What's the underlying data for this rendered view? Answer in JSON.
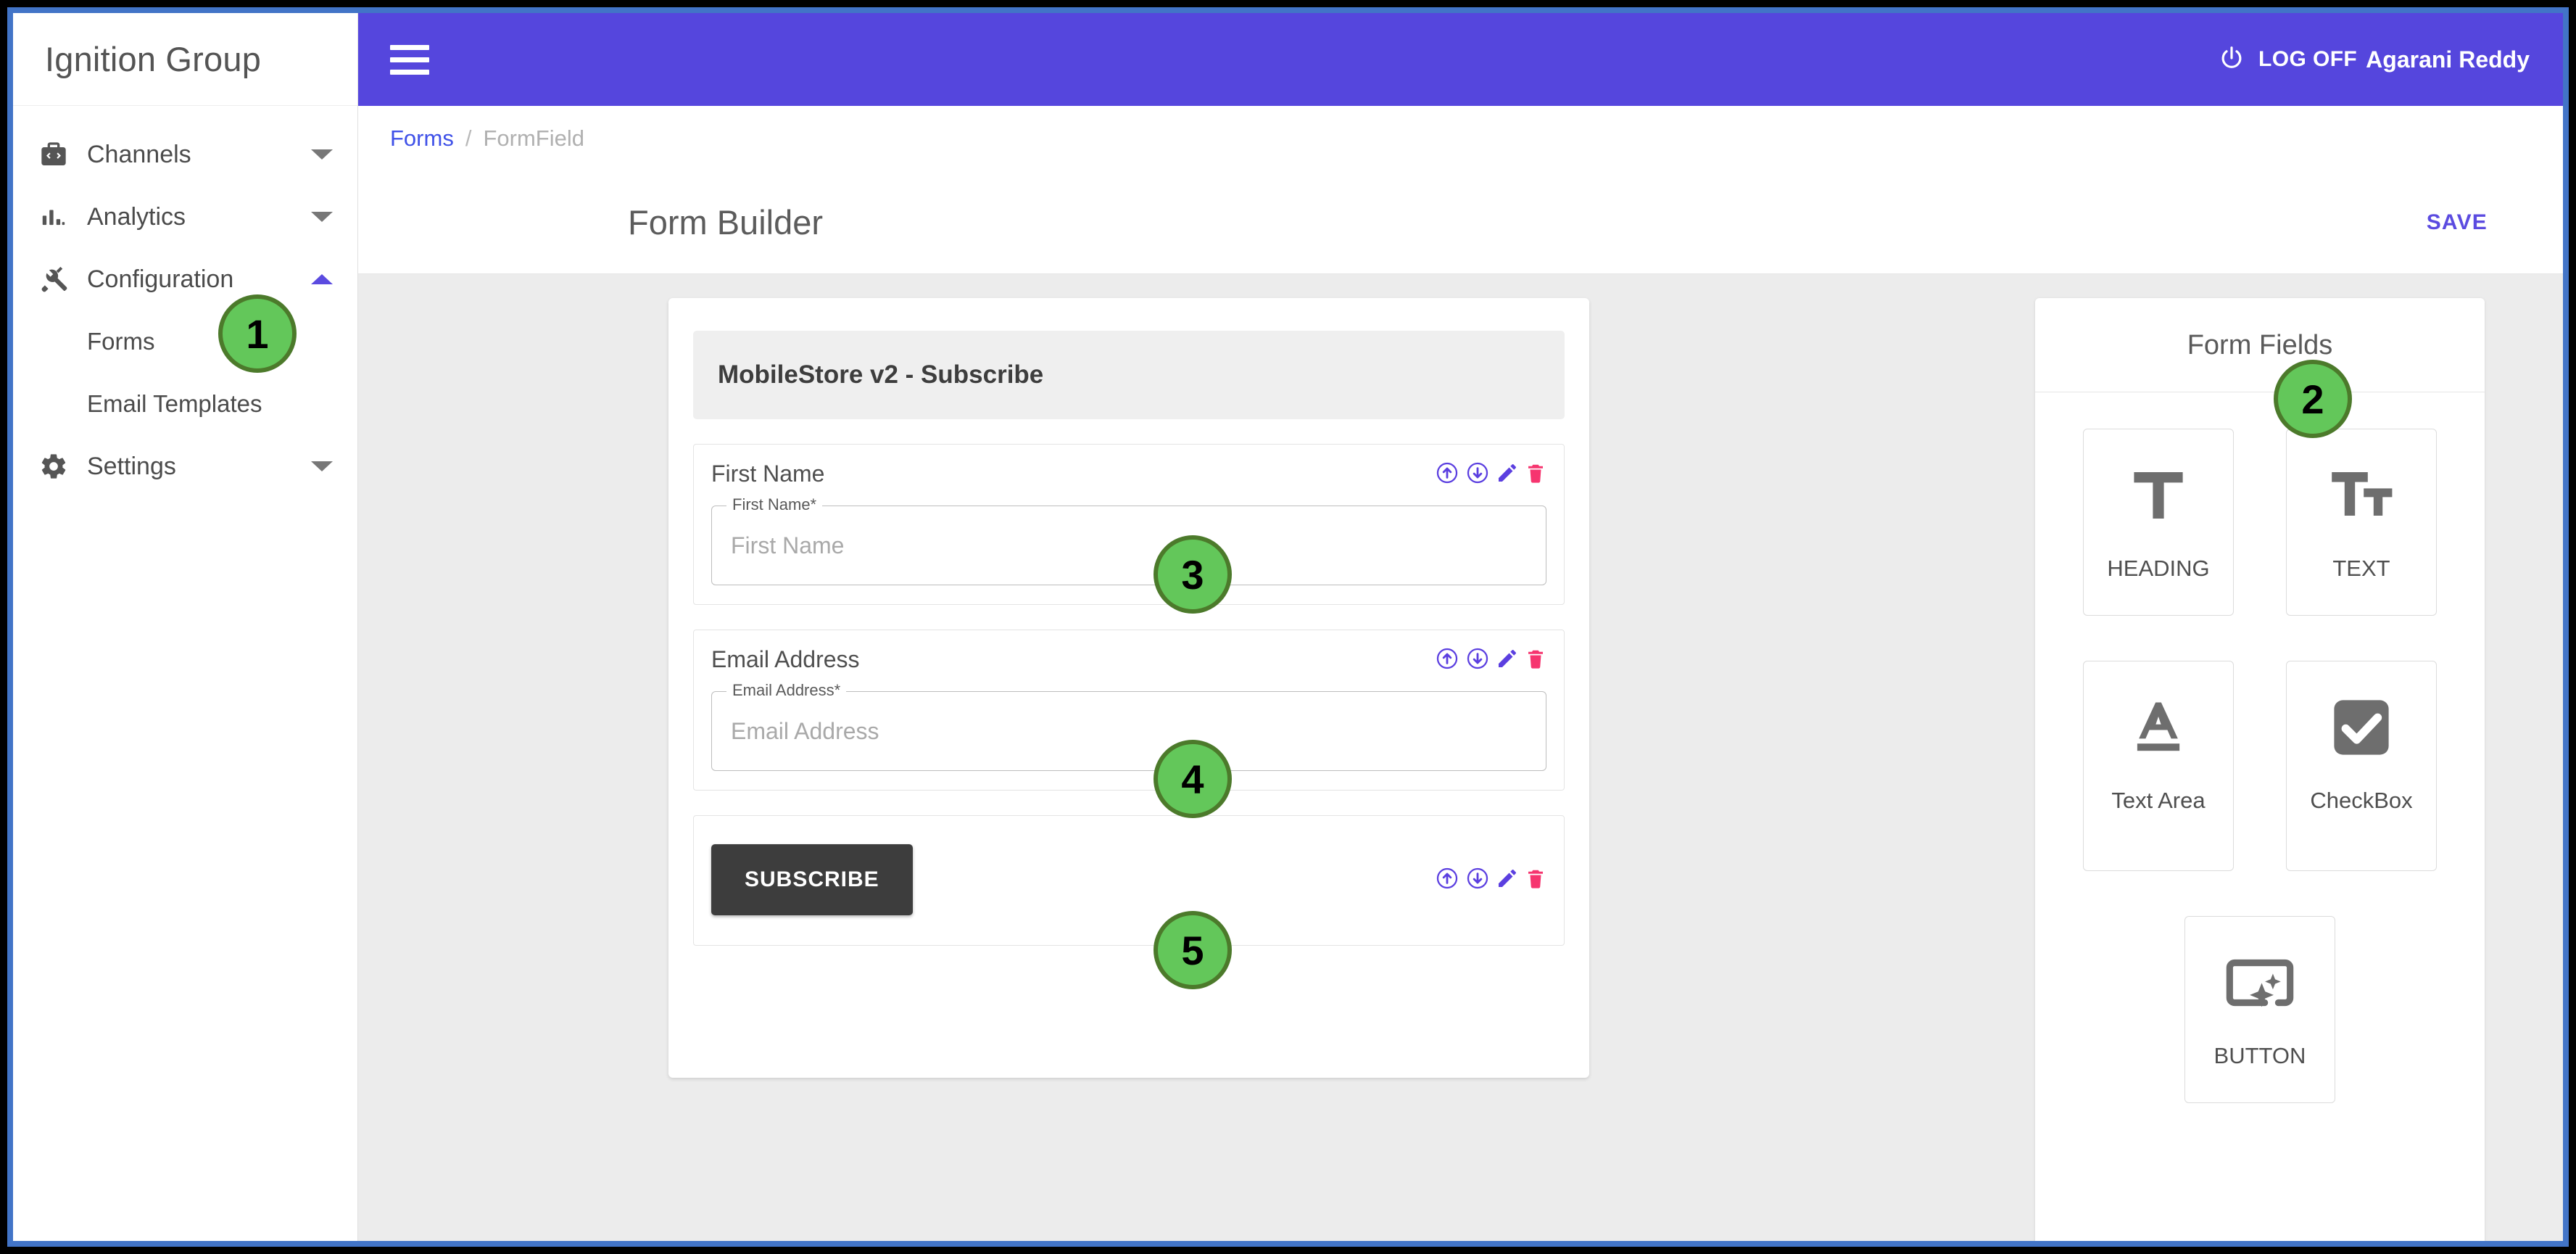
{
  "sidebar": {
    "brand": "Ignition Group",
    "items": [
      {
        "label": "Channels",
        "icon": "channels-icon",
        "caret": "down"
      },
      {
        "label": "Analytics",
        "icon": "analytics-icon",
        "caret": "down"
      },
      {
        "label": "Configuration",
        "icon": "configuration-icon",
        "caret": "up"
      },
      {
        "label": "Settings",
        "icon": "settings-gear-icon",
        "caret": "down"
      }
    ],
    "subitems": [
      {
        "label": "Forms"
      },
      {
        "label": "Email Templates"
      }
    ]
  },
  "topbar": {
    "menu_icon": "hamburger-menu-icon",
    "power_icon": "power-icon",
    "logoff_label": "LOG OFF",
    "user_name": "Agarani Reddy",
    "bg_color": "#5546dd"
  },
  "breadcrumb": {
    "parent": "Forms",
    "separator": "/",
    "current": "FormField"
  },
  "page": {
    "title": "Form Builder",
    "save_label": "SAVE",
    "accent_color": "#5b4be0"
  },
  "form": {
    "header_title": "MobileStore v2 - Subscribe",
    "fields": [
      {
        "caption": "First Name",
        "legend": "First Name*",
        "placeholder": "First Name",
        "actions": [
          "move-up-icon",
          "move-down-icon",
          "edit-icon",
          "delete-icon"
        ]
      },
      {
        "caption": "Email Address",
        "legend": "Email Address*",
        "placeholder": "Email Address",
        "actions": [
          "move-up-icon",
          "move-down-icon",
          "edit-icon",
          "delete-icon"
        ]
      }
    ],
    "submit": {
      "label": "SUBSCRIBE",
      "actions": [
        "move-up-icon",
        "move-down-icon",
        "edit-icon",
        "delete-icon"
      ]
    }
  },
  "fields_panel": {
    "title": "Form Fields",
    "tiles": [
      {
        "label": "HEADING",
        "icon": "heading-t-icon"
      },
      {
        "label": "TEXT",
        "icon": "text-tt-icon"
      },
      {
        "label": "Text Area",
        "icon": "text-area-a-icon"
      },
      {
        "label": "CheckBox",
        "icon": "checkbox-checked-icon"
      },
      {
        "label": "BUTTON",
        "icon": "button-sparkle-icon"
      }
    ]
  },
  "annotations": [
    {
      "number": "1"
    },
    {
      "number": "2"
    },
    {
      "number": "3"
    },
    {
      "number": "4"
    },
    {
      "number": "5"
    }
  ],
  "colors": {
    "header_purple": "#5546dd",
    "badge_green": "#63c75a",
    "badge_green_border": "#4c7a2b",
    "delete_pink": "#f6356f",
    "edit_purple": "#5b4be0",
    "link_blue": "#3f51e8",
    "content_bg": "#ececec",
    "frame_blue": "#4274c7"
  }
}
